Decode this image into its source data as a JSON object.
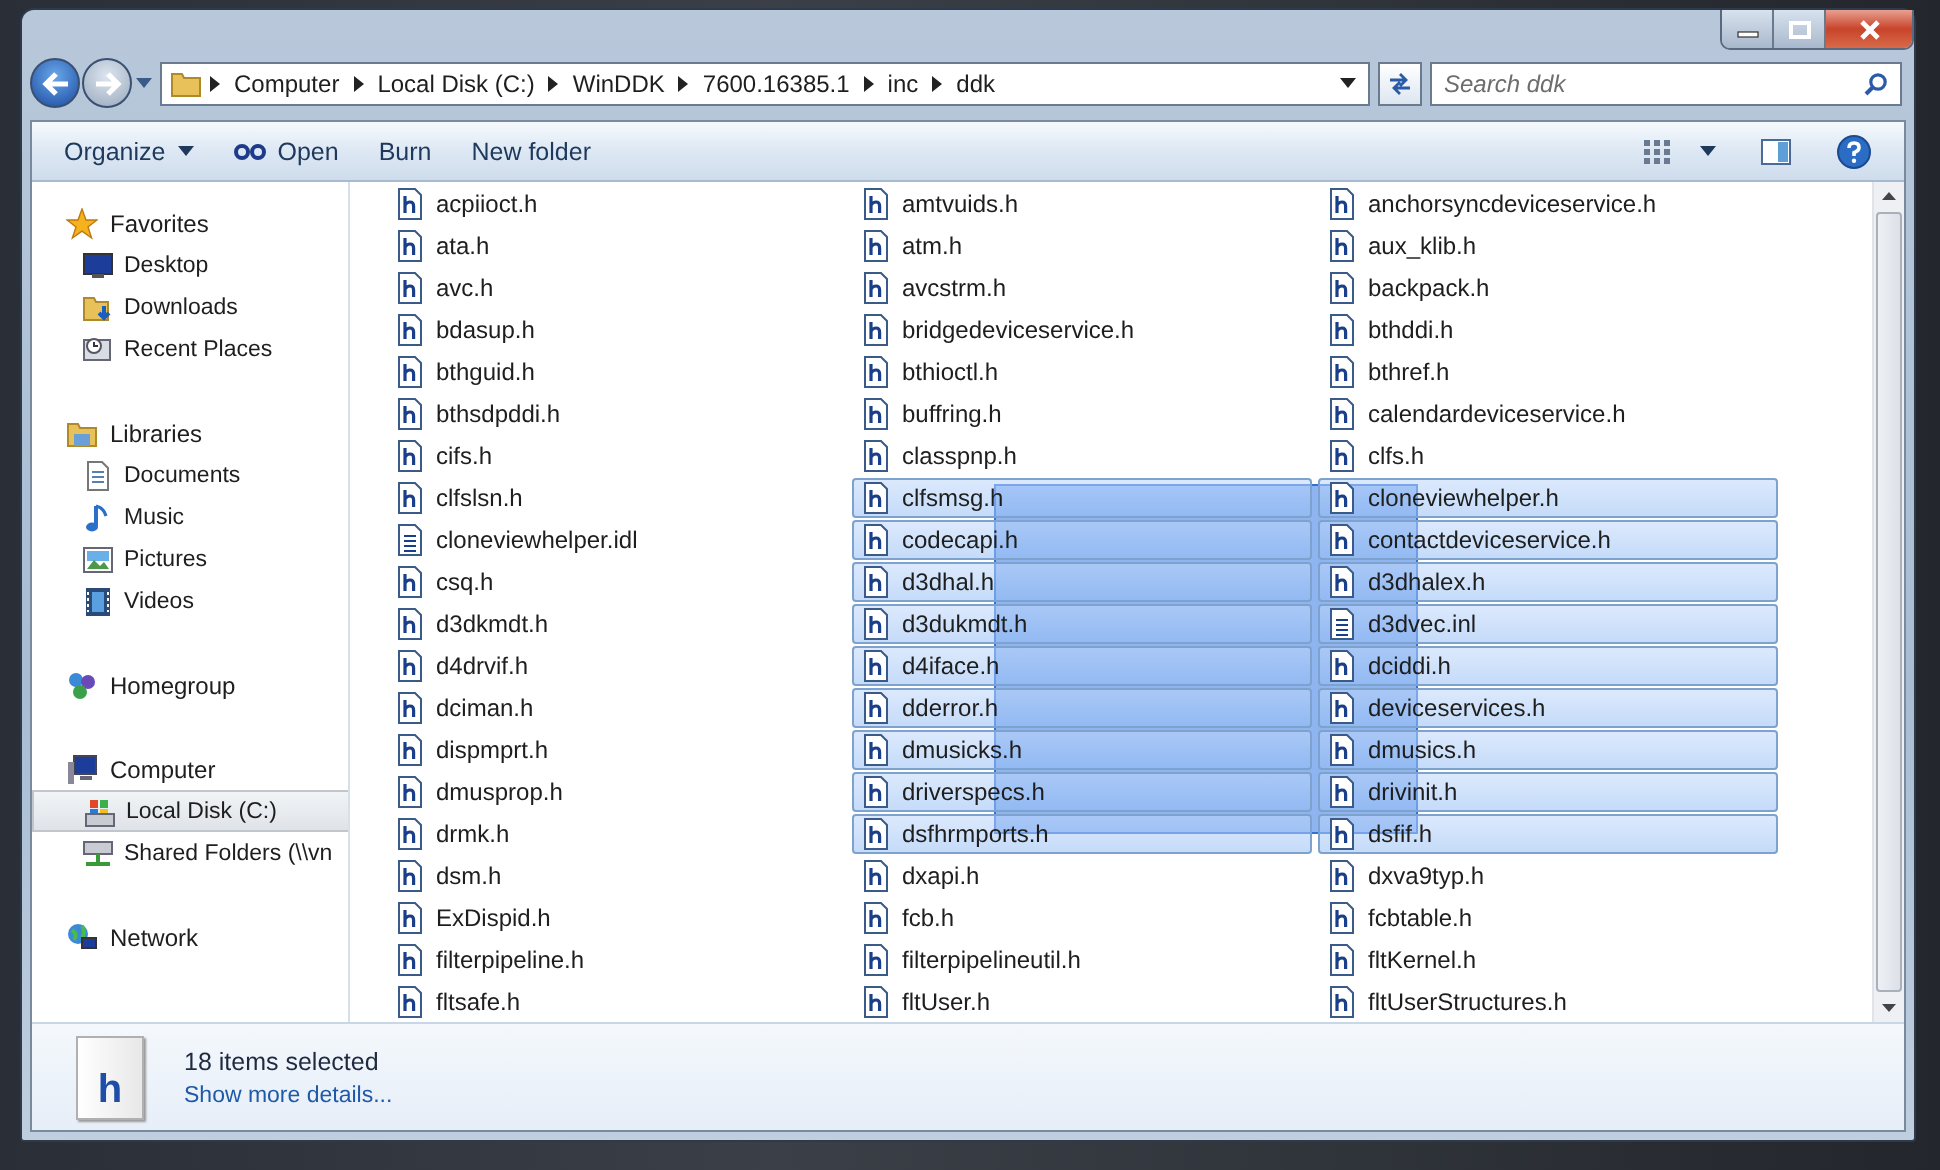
{
  "address_bar": {
    "crumbs": [
      "Computer",
      "Local Disk (C:)",
      "WinDDK",
      "7600.16385.1",
      "inc",
      "ddk"
    ]
  },
  "search": {
    "placeholder": "Search ddk"
  },
  "toolbar": {
    "items": [
      {
        "label": "Organize",
        "kind": "menu"
      },
      {
        "label": "Open",
        "kind": "open"
      },
      {
        "label": "Burn",
        "kind": "plain"
      },
      {
        "label": "New folder",
        "kind": "plain"
      }
    ]
  },
  "sidebar": {
    "groups": [
      {
        "label": "Favorites",
        "kind": "star",
        "selected": false,
        "children": [
          {
            "label": "Desktop",
            "kind": "desktop",
            "selected": false
          },
          {
            "label": "Downloads",
            "kind": "downloads",
            "selected": false
          },
          {
            "label": "Recent Places",
            "kind": "recent",
            "selected": false
          }
        ]
      },
      {
        "label": "Libraries",
        "kind": "library",
        "selected": false,
        "children": [
          {
            "label": "Documents",
            "kind": "document",
            "selected": false
          },
          {
            "label": "Music",
            "kind": "music",
            "selected": false
          },
          {
            "label": "Pictures",
            "kind": "pictures",
            "selected": false
          },
          {
            "label": "Videos",
            "kind": "videos",
            "selected": false
          }
        ]
      },
      {
        "label": "Homegroup",
        "kind": "homegroup",
        "selected": false
      },
      {
        "label": "Computer",
        "kind": "computer",
        "selected": false,
        "children": [
          {
            "label": "Local Disk (C:)",
            "kind": "drive",
            "selected": true
          },
          {
            "label": "Shared Folders (\\\\vn",
            "kind": "share",
            "selected": false
          }
        ]
      },
      {
        "label": "Network",
        "kind": "network",
        "selected": false
      }
    ]
  },
  "files": [
    {
      "name": "acpiioct.h",
      "kind": "header",
      "selected": false
    },
    {
      "name": "ata.h",
      "kind": "header",
      "selected": false
    },
    {
      "name": "avc.h",
      "kind": "header",
      "selected": false
    },
    {
      "name": "bdasup.h",
      "kind": "header",
      "selected": false
    },
    {
      "name": "bthguid.h",
      "kind": "header",
      "selected": false
    },
    {
      "name": "bthsdpddi.h",
      "kind": "header",
      "selected": false
    },
    {
      "name": "cifs.h",
      "kind": "header",
      "selected": false
    },
    {
      "name": "clfslsn.h",
      "kind": "header",
      "selected": false
    },
    {
      "name": "cloneviewhelper.idl",
      "kind": "text",
      "selected": false
    },
    {
      "name": "csq.h",
      "kind": "header",
      "selected": false
    },
    {
      "name": "d3dkmdt.h",
      "kind": "header",
      "selected": false
    },
    {
      "name": "d4drvif.h",
      "kind": "header",
      "selected": false
    },
    {
      "name": "dciman.h",
      "kind": "header",
      "selected": false
    },
    {
      "name": "dispmprt.h",
      "kind": "header",
      "selected": false
    },
    {
      "name": "dmusprop.h",
      "kind": "header",
      "selected": false
    },
    {
      "name": "drmk.h",
      "kind": "header",
      "selected": false
    },
    {
      "name": "dsm.h",
      "kind": "header",
      "selected": false
    },
    {
      "name": "ExDispid.h",
      "kind": "header",
      "selected": false
    },
    {
      "name": "filterpipeline.h",
      "kind": "header",
      "selected": false
    },
    {
      "name": "fltsafe.h",
      "kind": "header",
      "selected": false
    },
    {
      "name": "amtvuids.h",
      "kind": "header",
      "selected": false
    },
    {
      "name": "atm.h",
      "kind": "header",
      "selected": false
    },
    {
      "name": "avcstrm.h",
      "kind": "header",
      "selected": false
    },
    {
      "name": "bridgedeviceservice.h",
      "kind": "header",
      "selected": false
    },
    {
      "name": "bthioctl.h",
      "kind": "header",
      "selected": false
    },
    {
      "name": "buffring.h",
      "kind": "header",
      "selected": false
    },
    {
      "name": "classpnp.h",
      "kind": "header",
      "selected": false
    },
    {
      "name": "clfsmsg.h",
      "kind": "header",
      "selected": true
    },
    {
      "name": "codecapi.h",
      "kind": "header",
      "selected": true
    },
    {
      "name": "d3dhal.h",
      "kind": "header",
      "selected": true
    },
    {
      "name": "d3dukmdt.h",
      "kind": "header",
      "selected": true
    },
    {
      "name": "d4iface.h",
      "kind": "header",
      "selected": true
    },
    {
      "name": "dderror.h",
      "kind": "header",
      "selected": true
    },
    {
      "name": "dmusicks.h",
      "kind": "header",
      "selected": true
    },
    {
      "name": "driverspecs.h",
      "kind": "header",
      "selected": true
    },
    {
      "name": "dsfhrmports.h",
      "kind": "header",
      "selected": true
    },
    {
      "name": "dxapi.h",
      "kind": "header",
      "selected": false
    },
    {
      "name": "fcb.h",
      "kind": "header",
      "selected": false
    },
    {
      "name": "filterpipelineutil.h",
      "kind": "header",
      "selected": false
    },
    {
      "name": "fltUser.h",
      "kind": "header",
      "selected": false
    },
    {
      "name": "anchorsyncdeviceservice.h",
      "kind": "header",
      "selected": false
    },
    {
      "name": "aux_klib.h",
      "kind": "header",
      "selected": false
    },
    {
      "name": "backpack.h",
      "kind": "header",
      "selected": false
    },
    {
      "name": "bthddi.h",
      "kind": "header",
      "selected": false
    },
    {
      "name": "bthref.h",
      "kind": "header",
      "selected": false
    },
    {
      "name": "calendardeviceservice.h",
      "kind": "header",
      "selected": false
    },
    {
      "name": "clfs.h",
      "kind": "header",
      "selected": false
    },
    {
      "name": "cloneviewhelper.h",
      "kind": "header",
      "selected": true
    },
    {
      "name": "contactdeviceservice.h",
      "kind": "header",
      "selected": true
    },
    {
      "name": "d3dhalex.h",
      "kind": "header",
      "selected": true
    },
    {
      "name": "d3dvec.inl",
      "kind": "text",
      "selected": true
    },
    {
      "name": "dciddi.h",
      "kind": "header",
      "selected": true
    },
    {
      "name": "deviceservices.h",
      "kind": "header",
      "selected": true
    },
    {
      "name": "dmusics.h",
      "kind": "header",
      "selected": true
    },
    {
      "name": "drivinit.h",
      "kind": "header",
      "selected": true
    },
    {
      "name": "dsfif.h",
      "kind": "header",
      "selected": true
    },
    {
      "name": "dxva9typ.h",
      "kind": "header",
      "selected": false
    },
    {
      "name": "fcbtable.h",
      "kind": "header",
      "selected": false
    },
    {
      "name": "fltKernel.h",
      "kind": "header",
      "selected": false
    },
    {
      "name": "fltUserStructures.h",
      "kind": "header",
      "selected": false
    }
  ],
  "drag_selection": true,
  "details": {
    "icon_letter": "h",
    "summary": "18 items selected",
    "link": "Show more details..."
  }
}
